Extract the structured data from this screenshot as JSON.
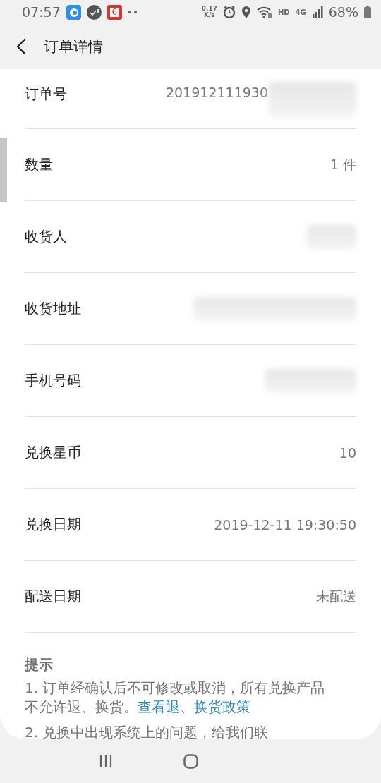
{
  "status_bar": {
    "time": "07:57",
    "calendar_day": "6",
    "net_speed": "0.17",
    "net_unit": "K/s",
    "hd": "HD",
    "network": "4G",
    "battery": "68%"
  },
  "header": {
    "title": "订单详情"
  },
  "rows": [
    {
      "label": "订单号",
      "value": "201912111930",
      "redacted": true
    },
    {
      "label": "数量",
      "value": "1 件"
    },
    {
      "label": "收货人",
      "redacted": true
    },
    {
      "label": "收货地址",
      "redacted": true
    },
    {
      "label": "手机号码",
      "redacted": true
    },
    {
      "label": "兑换星币",
      "value": "10"
    },
    {
      "label": "兑换日期",
      "value": "2019-12-11 19:30:50"
    },
    {
      "label": "配送日期",
      "value": "未配送"
    }
  ],
  "tips": {
    "title": "提示",
    "items": [
      {
        "text": "1. 订单经确认后不可修改或取消，所有兑换产品不允许退、换货。",
        "link": "查看退、换货政策"
      },
      {
        "text": "2. 兑换中出现系统上的问题，给我们联"
      }
    ]
  }
}
